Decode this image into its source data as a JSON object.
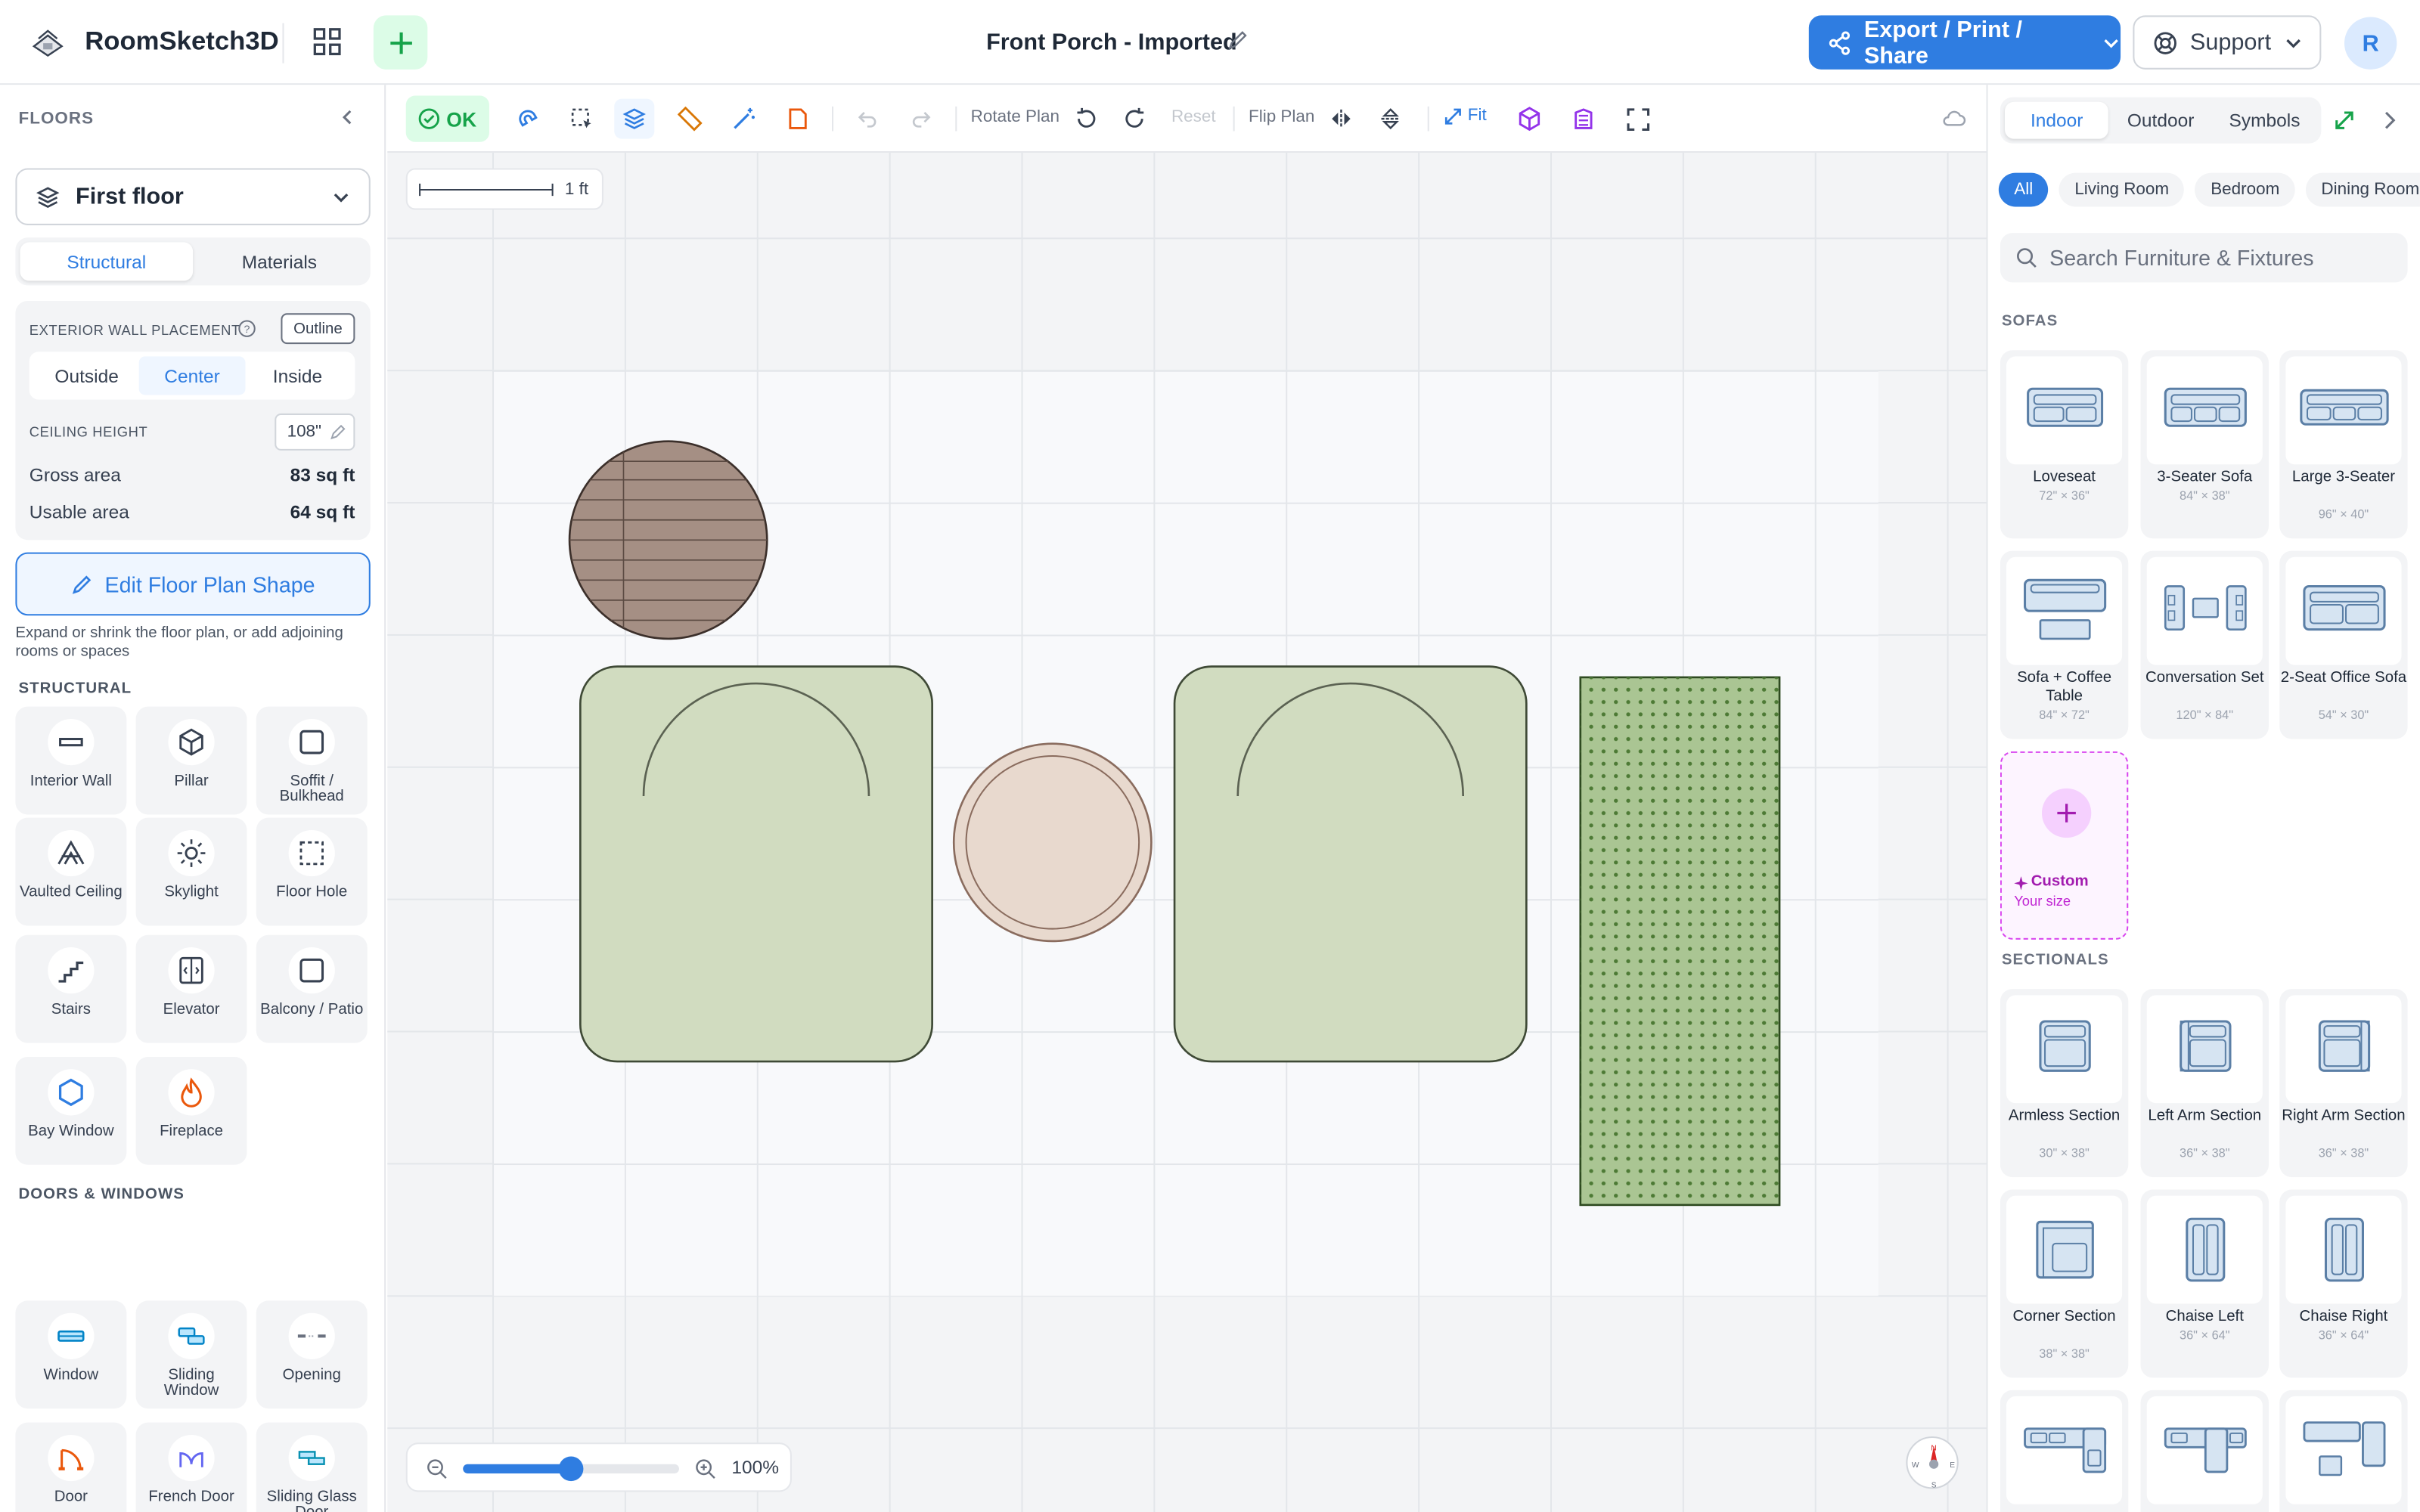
{
  "header": {
    "app_name": "RoomSketch3D",
    "document_title": "Front Porch - Imported",
    "export_label": "Export / Print / Share",
    "support_label": "Support",
    "avatar_initial": "R"
  },
  "left_panel": {
    "title": "FLOORS",
    "floor_select": "First floor",
    "tabs": [
      "Structural",
      "Materials"
    ],
    "active_tab": "Structural",
    "exterior_wall_label": "EXTERIOR WALL PLACEMENT",
    "outline_label": "Outline",
    "wall_options": [
      "Outside",
      "Center",
      "Inside"
    ],
    "active_wall_option": "Center",
    "ceiling_label": "CEILING HEIGHT",
    "ceiling_value": "108\"",
    "gross_label": "Gross area",
    "gross_value": "83 sq ft",
    "usable_label": "Usable area",
    "usable_value": "64 sq ft",
    "edit_shape_label": "Edit Floor Plan Shape",
    "expand_text": "Expand or shrink the floor plan, or add adjoining rooms or spaces",
    "structural_title": "STRUCTURAL",
    "structural_items": [
      {
        "label": "Interior Wall",
        "icon": "interior-wall-icon"
      },
      {
        "label": "Pillar",
        "icon": "pillar-icon"
      },
      {
        "label": "Soffit / Bulkhead",
        "icon": "soffit-icon"
      },
      {
        "label": "Vaulted Ceiling",
        "icon": "vaulted-ceiling-icon"
      },
      {
        "label": "Skylight",
        "icon": "skylight-icon"
      },
      {
        "label": "Floor Hole",
        "icon": "floor-hole-icon"
      },
      {
        "label": "Stairs",
        "icon": "stairs-icon"
      },
      {
        "label": "Elevator",
        "icon": "elevator-icon"
      },
      {
        "label": "Balcony / Patio",
        "icon": "balcony-icon"
      },
      {
        "label": "Bay Window",
        "icon": "bay-window-icon"
      },
      {
        "label": "Fireplace",
        "icon": "fireplace-icon"
      }
    ],
    "doors_title": "DOORS & WINDOWS",
    "door_items": [
      {
        "label": "Window",
        "icon": "window-icon"
      },
      {
        "label": "Sliding Window",
        "icon": "sliding-window-icon"
      },
      {
        "label": "Opening",
        "icon": "opening-icon"
      },
      {
        "label": "Door",
        "icon": "door-icon"
      },
      {
        "label": "French Door",
        "icon": "french-door-icon"
      },
      {
        "label": "Sliding Glass Door",
        "icon": "sliding-glass-door-icon"
      }
    ]
  },
  "toolbar": {
    "ok_label": "OK",
    "rotate_label": "Rotate Plan",
    "reset_label": "Reset",
    "flip_label": "Flip Plan",
    "fit_label": "Fit"
  },
  "canvas": {
    "scale_label": "1 ft",
    "zoom_label": "100%",
    "zoom_level": 0.5,
    "compass": [
      "N",
      "E",
      "S",
      "W"
    ]
  },
  "right_panel": {
    "tabs": [
      "Indoor",
      "Outdoor",
      "Symbols"
    ],
    "active_tab": "Indoor",
    "chips": [
      "All",
      "Living Room",
      "Bedroom",
      "Dining Room"
    ],
    "active_chip": "All",
    "search_placeholder": "Search Furniture & Fixtures",
    "sofas_title": "SOFAS",
    "sofas": [
      {
        "name": "Loveseat",
        "dims": "72\" × 36\""
      },
      {
        "name": "3-Seater Sofa",
        "dims": "84\" × 38\""
      },
      {
        "name": "Large 3-Seater",
        "dims": "96\" × 40\""
      },
      {
        "name": "Sofa + Coffee Table",
        "dims": "84\" × 72\""
      },
      {
        "name": "Conversation Set",
        "dims": "120\" × 84\""
      },
      {
        "name": "2-Seat Office Sofa",
        "dims": "54\" × 30\""
      }
    ],
    "custom_label": "Custom",
    "custom_sub": "Your size",
    "sectionals_title": "SECTIONALS",
    "sectionals": [
      {
        "name": "Armless Section",
        "dims": "30\" × 38\""
      },
      {
        "name": "Left Arm Section",
        "dims": "36\" × 38\""
      },
      {
        "name": "Right Arm Section",
        "dims": "36\" × 38\""
      },
      {
        "name": "Corner Section",
        "dims": "38\" × 38\""
      },
      {
        "name": "Chaise Left",
        "dims": "36\" × 64\""
      },
      {
        "name": "Chaise Right",
        "dims": "36\" × 64\""
      }
    ]
  },
  "colors": {
    "accent": "#2f7de1",
    "ok_green": "#16a34a",
    "chair_fill": "#d1dcc0",
    "table_fill": "#a58f84",
    "side_table_fill": "#e8d9ce",
    "rug_fill": "#aac593",
    "custom_magenta": "#a21caf"
  }
}
